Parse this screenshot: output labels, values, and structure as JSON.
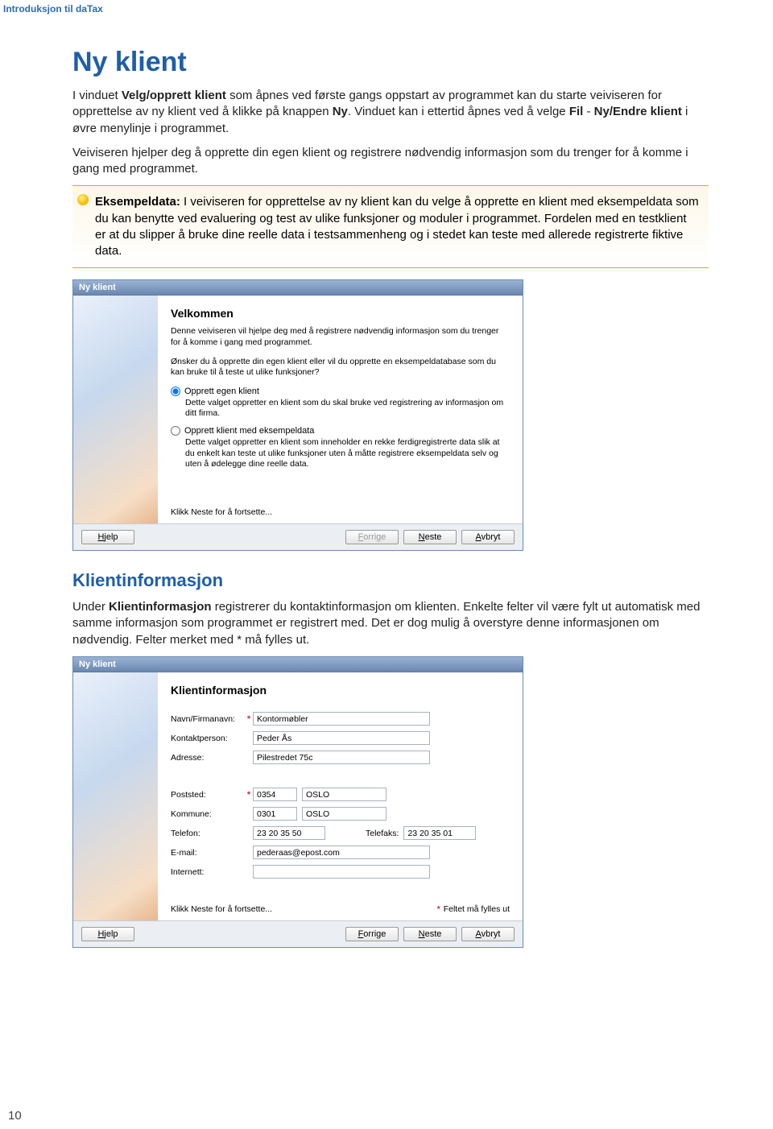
{
  "header": "Introduksjon til daTax",
  "title": "Ny klient",
  "para1_parts": {
    "a": "I vinduet ",
    "b": "Velg/opprett klient",
    "c": " som åpnes ved første gangs oppstart av programmet kan du starte veiviseren for opprettelse av ny klient ved å klikke på knappen ",
    "d": "Ny",
    "e": ". Vinduet kan i ettertid åpnes ved å velge ",
    "f": "Fil",
    "g": " - ",
    "h": "Ny/Endre klient",
    "i": " i øvre menylinje i programmet."
  },
  "para2": "Veiviseren hjelper deg å opprette din egen klient og registrere nødvendig informasjon som du trenger for å komme i gang med programmet.",
  "tip": {
    "a": "Eksempeldata:",
    "b": " I veiviseren for opprettelse av ny klient kan du velge å opprette en klient med eksempeldata som du kan benytte ved evaluering og test av ulike funksjoner og moduler i programmet. Fordelen med en testklient er at du slipper å bruke dine reelle data i testsammenheng og i stedet kan teste med allerede registrerte fiktive data."
  },
  "wizard1": {
    "title": "Ny klient",
    "heading": "Velkommen",
    "desc1": "Denne veiviseren vil hjelpe deg med å registrere nødvendig informasjon som du trenger for å komme i gang med programmet.",
    "desc2": "Ønsker du å opprette din egen klient eller vil du opprette en eksempeldatabase som du kan bruke til å teste ut ulike funksjoner?",
    "opt1": {
      "label": "Opprett egen klient",
      "desc": "Dette valget oppretter en klient som du skal bruke ved registrering av informasjon om ditt firma."
    },
    "opt2": {
      "label": "Opprett klient med eksempeldata",
      "desc": "Dette valget oppretter en klient som inneholder en rekke ferdigregistrerte data slik at du enkelt kan teste ut ulike funksjoner uten å måtte registrere eksempeldata selv og uten å ødelegge dine reelle data."
    },
    "continue": "Klikk Neste for å fortsette...",
    "btn_help": "Hjelp",
    "btn_prev": "Forrige",
    "btn_next": "Neste",
    "btn_cancel": "Avbryt"
  },
  "subsection": "Klientinformasjon",
  "para3_parts": {
    "a": "Under ",
    "b": "Klientinformasjon",
    "c": " registrerer du kontaktinformasjon om klienten. Enkelte felter vil være fylt ut automatisk med samme informasjon som programmet er registrert med. Det er dog mulig å overstyre denne informasjonen om nødvendig. Felter merket med * må fylles ut."
  },
  "wizard2": {
    "title": "Ny klient",
    "heading": "Klientinformasjon",
    "fields": {
      "name_label": "Navn/Firmanavn:",
      "name_value": "Kontormøbler",
      "contact_label": "Kontaktperson:",
      "contact_value": "Peder Ås",
      "address_label": "Adresse:",
      "address_value": "Pilestredet 75c",
      "post_label": "Poststed:",
      "post_code": "0354",
      "post_city": "OSLO",
      "kommune_label": "Kommune:",
      "kommune_code": "0301",
      "kommune_city": "OSLO",
      "phone_label": "Telefon:",
      "phone_value": "23 20 35 50",
      "fax_label": "Telefaks:",
      "fax_value": "23 20 35 01",
      "email_label": "E-mail:",
      "email_value": "pederaas@epost.com",
      "internet_label": "Internett:"
    },
    "continue": "Klikk Neste for å fortsette...",
    "req_note": "Feltet må fylles ut",
    "btn_help": "Hjelp",
    "btn_prev": "Forrige",
    "btn_next": "Neste",
    "btn_cancel": "Avbryt"
  },
  "page_number": "10"
}
